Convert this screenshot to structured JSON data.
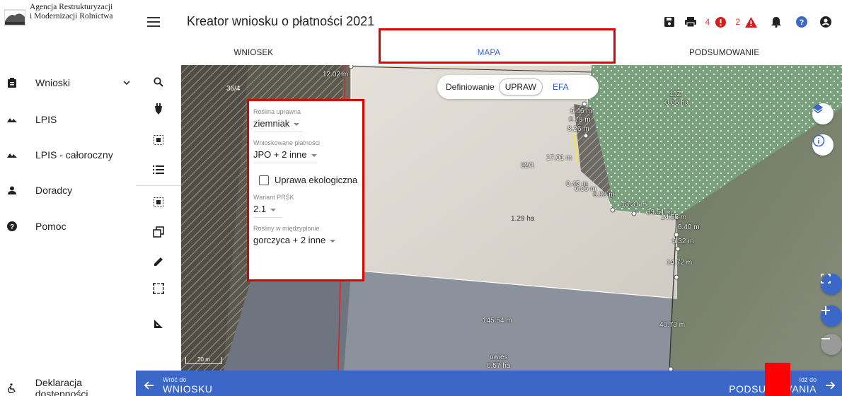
{
  "brand": {
    "line1": "Agencja Restrukturyzacji",
    "line2": "i Modernizacji Rolnictwa",
    "logo_mark_text": "ARiMR"
  },
  "header": {
    "title": "Kreator wniosku o płatności 2021",
    "error_count": "4",
    "warning_count": "2"
  },
  "tabs": [
    {
      "label": "WNIOSEK"
    },
    {
      "label": "MAPA"
    },
    {
      "label": "PODSUMOWANIE"
    }
  ],
  "sidebar": {
    "items": [
      {
        "label": "Wnioski",
        "icon": "clipboard-icon"
      },
      {
        "label": "LPIS",
        "icon": "terrain-icon"
      },
      {
        "label": "LPIS - całoroczny",
        "icon": "terrain-icon"
      },
      {
        "label": "Doradcy",
        "icon": "person-icon"
      },
      {
        "label": "Pomoc",
        "icon": "help-icon"
      }
    ],
    "footer": {
      "label": "Deklaracja dostępności",
      "icon": "accessibility-icon"
    }
  },
  "mode_toggle": {
    "label": "Definiowanie",
    "options": [
      "UPRAW",
      "EFA"
    ],
    "selected": "UPRAW"
  },
  "crop_panel": {
    "crop_label": "Roślina uprawna",
    "crop_value": "ziemniak",
    "payments_label": "Wnioskowane płatności",
    "payments_value": "JPO + 2 inne",
    "organic_label": "Uprawa ekologiczna",
    "organic_checked": false,
    "variant_label": "Wariant PRŚK",
    "variant_value": "2.1",
    "catch_crops_label": "Rośliny w międzyplonie",
    "catch_crops_value": "gorczyca + 2 inne"
  },
  "map": {
    "labels": {
      "parcel_36_4": "36/4",
      "parcel_32_1": "32/1",
      "area_main": "1.29 ha",
      "area_efa": "0.66 ha",
      "efa_code": "1JZ",
      "d_top": "12.02 m",
      "d1": "6.46 m",
      "d2": "0.79 m",
      "d3": "8.26 m",
      "d4": "17.01 m",
      "d5": "0.45 m",
      "d6": "6.06 m",
      "d7": "6.93 m",
      "d8": "13.31 m",
      "d9": "33.51 m",
      "d10": "14.55 m",
      "d11": "6.40 m",
      "d12": "6.32 m",
      "d13": "14.72 m",
      "d14": "145.54 m",
      "d15": "40.73 m",
      "crop_below": "owies",
      "area_below": "0.57 ha",
      "scale": "20 m"
    }
  },
  "bottom": {
    "back_caption": "Wróć do",
    "back_label": "WNIOSKU",
    "next_caption": "Idź do",
    "next_label": "PODSUMOWANIA"
  }
}
